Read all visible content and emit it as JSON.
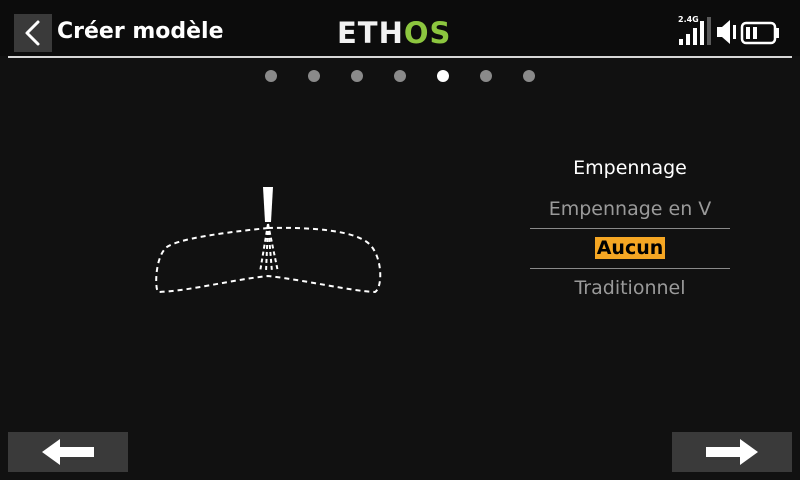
{
  "header": {
    "title": "Créer modèle",
    "logo_part1": "ETH",
    "logo_part2": "OS",
    "rf_band": "2.4G"
  },
  "colors": {
    "accent": "#f5a623",
    "logo_green": "#8cc63f",
    "background": "#111111",
    "button": "#3a3a3a"
  },
  "pager": {
    "total_pages": 7,
    "current_page": 5
  },
  "tail_selector": {
    "heading": "Empennage",
    "options": [
      "Empennage en V",
      "Aucun",
      "Traditionnel"
    ],
    "selected_index": 1
  },
  "icons": {
    "back": "chevron-left-icon",
    "prev": "arrow-left-icon",
    "next": "arrow-right-icon",
    "signal": "signal-bars-icon",
    "volume": "speaker-icon",
    "battery": "battery-icon"
  }
}
